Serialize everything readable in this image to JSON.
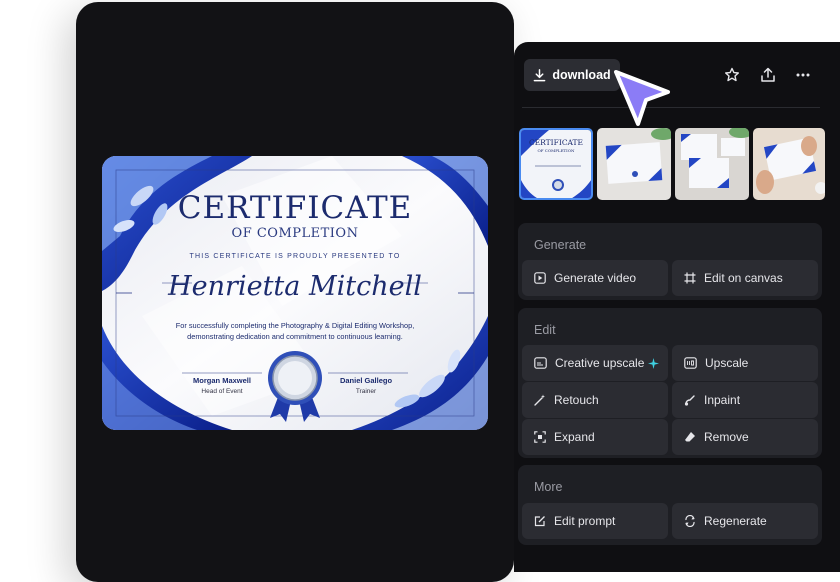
{
  "certificate": {
    "title": "CERTIFICATE",
    "subtitle": "OF COMPLETION",
    "presented_to": "THIS CERTIFICATE IS PROUDLY PRESENTED TO",
    "recipient": "Henrietta Mitchell",
    "description": "For successfully completing the Photography & Digital Editing Workshop, demonstrating dedication and commitment to continuous learning.",
    "signer_left": {
      "name": "Morgan Maxwell",
      "role": "Head of Event"
    },
    "signer_right": {
      "name": "Daniel Gallego",
      "role": "Trainer"
    }
  },
  "toolbar": {
    "download_label": "download",
    "icons": [
      "star-icon",
      "share-icon",
      "more-icon"
    ]
  },
  "thumbnails": [
    {
      "title": "CERTIFICATE",
      "subtitle": "OF COMPLETION"
    },
    {
      "title": "",
      "subtitle": ""
    },
    {
      "title": "",
      "subtitle": ""
    },
    {
      "title": "",
      "subtitle": ""
    }
  ],
  "sections": {
    "generate": {
      "title": "Generate",
      "actions": [
        {
          "label": "Generate video",
          "icon": "video-icon"
        },
        {
          "label": "Edit on canvas",
          "icon": "canvas-icon"
        }
      ]
    },
    "edit": {
      "title": "Edit",
      "actions": [
        {
          "label": "Creative upscale",
          "icon": "creative-upscale-icon"
        },
        {
          "label": "Upscale",
          "icon": "upscale-icon"
        },
        {
          "label": "Retouch",
          "icon": "retouch-icon"
        },
        {
          "label": "Inpaint",
          "icon": "inpaint-icon"
        },
        {
          "label": "Expand",
          "icon": "expand-icon"
        },
        {
          "label": "Remove",
          "icon": "eraser-icon"
        }
      ]
    },
    "more": {
      "title": "More",
      "actions": [
        {
          "label": "Edit prompt",
          "icon": "edit-prompt-icon"
        },
        {
          "label": "Regenerate",
          "icon": "regenerate-icon"
        }
      ]
    }
  },
  "colors": {
    "accent": "#8b7cf6",
    "sparkle": "#3fd0e0",
    "panel": "#0f0f12",
    "section": "#1e1f24",
    "button": "#2b2c32"
  }
}
